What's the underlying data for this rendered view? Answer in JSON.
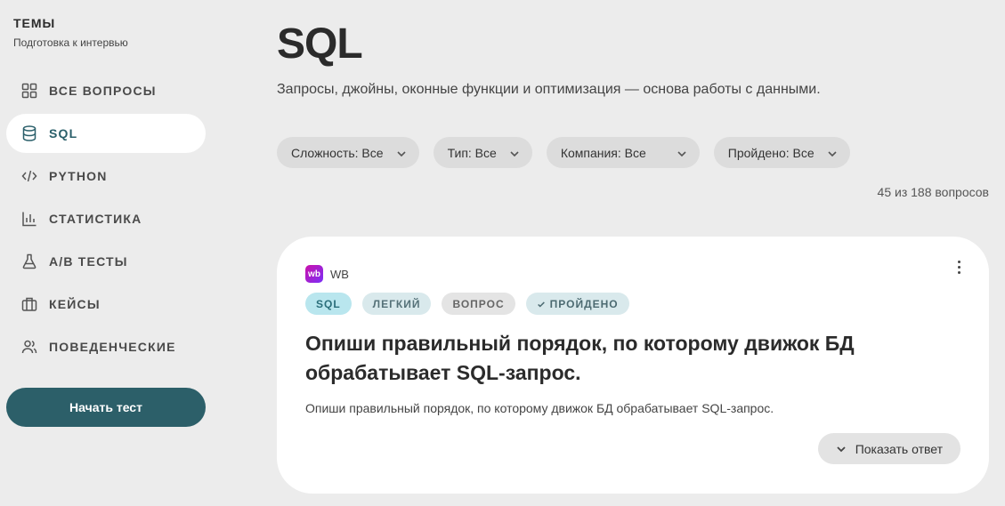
{
  "sidebar": {
    "title": "ТЕМЫ",
    "subtitle": "Подготовка к интервью",
    "items": [
      {
        "label": "ВСЕ ВОПРОСЫ",
        "icon": "grid-icon"
      },
      {
        "label": "SQL",
        "icon": "database-icon",
        "active": true
      },
      {
        "label": "PYTHON",
        "icon": "code-icon"
      },
      {
        "label": "СТАТИСТИКА",
        "icon": "bar-chart-icon"
      },
      {
        "label": "A/B ТЕСТЫ",
        "icon": "flask-icon"
      },
      {
        "label": "КЕЙСЫ",
        "icon": "briefcase-icon"
      },
      {
        "label": "ПОВЕДЕНЧЕСКИЕ",
        "icon": "users-icon"
      }
    ],
    "start_button": "Начать тест"
  },
  "main": {
    "title": "SQL",
    "description": "Запросы, джойны, оконные функции и оптимизация — основа работы с данными.",
    "filters": [
      {
        "label": "Сложность: Все"
      },
      {
        "label": "Тип: Все"
      },
      {
        "label": "Компания: Все"
      },
      {
        "label": "Пройдено: Все"
      }
    ],
    "count": "45 из 188 вопросов"
  },
  "card": {
    "company_logo_text": "wb",
    "company": "WB",
    "tags": {
      "sql": "SQL",
      "level": "ЛЕГКИЙ",
      "type": "ВОПРОС",
      "done": "ПРОЙДЕНО"
    },
    "title": "Опиши правильный порядок, по которому движок БД обрабатывает SQL-запрос.",
    "text": "Опиши правильный порядок, по которому движок БД обрабатывает SQL-запрос.",
    "show_answer": "Показать ответ"
  },
  "colors": {
    "accent": "#2c5f69",
    "background": "#ececec",
    "card": "#ffffff"
  }
}
